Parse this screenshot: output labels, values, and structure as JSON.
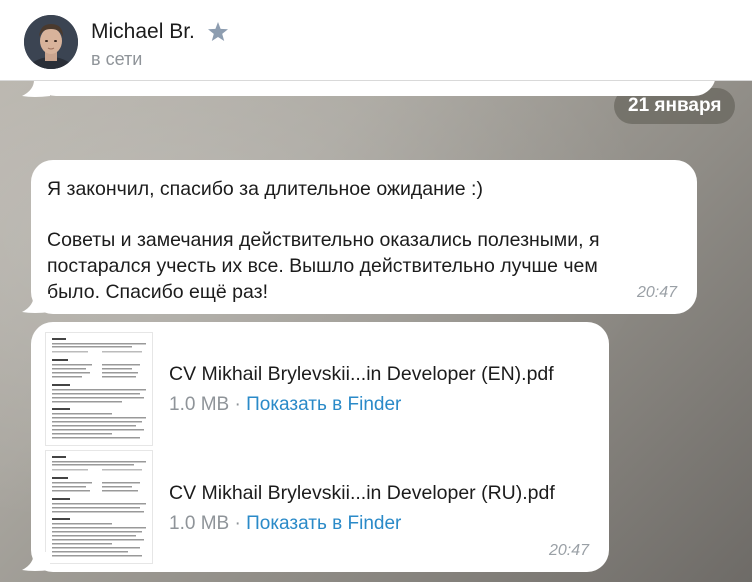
{
  "header": {
    "contact_name": "Michael Br.",
    "status": "в сети",
    "icons": [
      "avatar",
      "star-icon"
    ]
  },
  "date_separator": "21 января",
  "messages": [
    {
      "lines": [
        "Я закончил, спасибо за длительное ожидание :)",
        "Советы и замечания действительно оказались полезными, я",
        "постарался учесть их все. Вышло действительно лучше чем",
        "было. Спасибо ещё раз!"
      ],
      "time": "20:47"
    }
  ],
  "files": [
    {
      "name": "CV Mikhail Brylevskii...in Developer (EN).pdf",
      "size": "1.0 MB",
      "action": "Показать в Finder"
    },
    {
      "name": "CV Mikhail Brylevskii...in Developer (RU).pdf",
      "size": "1.0 MB",
      "action": "Показать в Finder"
    }
  ],
  "files_time": "20:47",
  "colors": {
    "link": "#2a8ac8",
    "bubble": "#ffffff",
    "muted_text": "#8f9499",
    "date_pill": "#5a584e",
    "star": "#8d9db0"
  }
}
